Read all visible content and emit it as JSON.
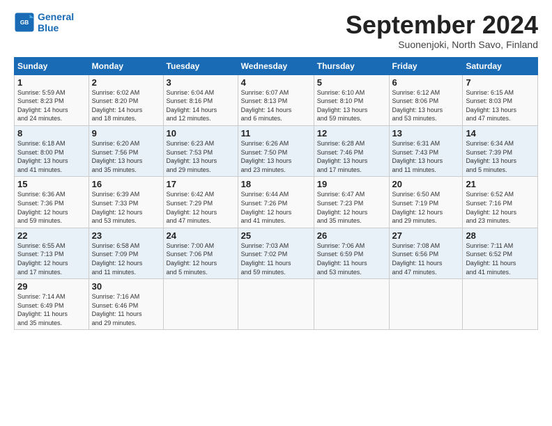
{
  "logo": {
    "line1": "General",
    "line2": "Blue"
  },
  "title": "September 2024",
  "subtitle": "Suonenjoki, North Savo, Finland",
  "headers": [
    "Sunday",
    "Monday",
    "Tuesday",
    "Wednesday",
    "Thursday",
    "Friday",
    "Saturday"
  ],
  "weeks": [
    [
      {
        "day": "1",
        "info": "Sunrise: 5:59 AM\nSunset: 8:23 PM\nDaylight: 14 hours\nand 24 minutes."
      },
      {
        "day": "2",
        "info": "Sunrise: 6:02 AM\nSunset: 8:20 PM\nDaylight: 14 hours\nand 18 minutes."
      },
      {
        "day": "3",
        "info": "Sunrise: 6:04 AM\nSunset: 8:16 PM\nDaylight: 14 hours\nand 12 minutes."
      },
      {
        "day": "4",
        "info": "Sunrise: 6:07 AM\nSunset: 8:13 PM\nDaylight: 14 hours\nand 6 minutes."
      },
      {
        "day": "5",
        "info": "Sunrise: 6:10 AM\nSunset: 8:10 PM\nDaylight: 13 hours\nand 59 minutes."
      },
      {
        "day": "6",
        "info": "Sunrise: 6:12 AM\nSunset: 8:06 PM\nDaylight: 13 hours\nand 53 minutes."
      },
      {
        "day": "7",
        "info": "Sunrise: 6:15 AM\nSunset: 8:03 PM\nDaylight: 13 hours\nand 47 minutes."
      }
    ],
    [
      {
        "day": "8",
        "info": "Sunrise: 6:18 AM\nSunset: 8:00 PM\nDaylight: 13 hours\nand 41 minutes."
      },
      {
        "day": "9",
        "info": "Sunrise: 6:20 AM\nSunset: 7:56 PM\nDaylight: 13 hours\nand 35 minutes."
      },
      {
        "day": "10",
        "info": "Sunrise: 6:23 AM\nSunset: 7:53 PM\nDaylight: 13 hours\nand 29 minutes."
      },
      {
        "day": "11",
        "info": "Sunrise: 6:26 AM\nSunset: 7:50 PM\nDaylight: 13 hours\nand 23 minutes."
      },
      {
        "day": "12",
        "info": "Sunrise: 6:28 AM\nSunset: 7:46 PM\nDaylight: 13 hours\nand 17 minutes."
      },
      {
        "day": "13",
        "info": "Sunrise: 6:31 AM\nSunset: 7:43 PM\nDaylight: 13 hours\nand 11 minutes."
      },
      {
        "day": "14",
        "info": "Sunrise: 6:34 AM\nSunset: 7:39 PM\nDaylight: 13 hours\nand 5 minutes."
      }
    ],
    [
      {
        "day": "15",
        "info": "Sunrise: 6:36 AM\nSunset: 7:36 PM\nDaylight: 12 hours\nand 59 minutes."
      },
      {
        "day": "16",
        "info": "Sunrise: 6:39 AM\nSunset: 7:33 PM\nDaylight: 12 hours\nand 53 minutes."
      },
      {
        "day": "17",
        "info": "Sunrise: 6:42 AM\nSunset: 7:29 PM\nDaylight: 12 hours\nand 47 minutes."
      },
      {
        "day": "18",
        "info": "Sunrise: 6:44 AM\nSunset: 7:26 PM\nDaylight: 12 hours\nand 41 minutes."
      },
      {
        "day": "19",
        "info": "Sunrise: 6:47 AM\nSunset: 7:23 PM\nDaylight: 12 hours\nand 35 minutes."
      },
      {
        "day": "20",
        "info": "Sunrise: 6:50 AM\nSunset: 7:19 PM\nDaylight: 12 hours\nand 29 minutes."
      },
      {
        "day": "21",
        "info": "Sunrise: 6:52 AM\nSunset: 7:16 PM\nDaylight: 12 hours\nand 23 minutes."
      }
    ],
    [
      {
        "day": "22",
        "info": "Sunrise: 6:55 AM\nSunset: 7:13 PM\nDaylight: 12 hours\nand 17 minutes."
      },
      {
        "day": "23",
        "info": "Sunrise: 6:58 AM\nSunset: 7:09 PM\nDaylight: 12 hours\nand 11 minutes."
      },
      {
        "day": "24",
        "info": "Sunrise: 7:00 AM\nSunset: 7:06 PM\nDaylight: 12 hours\nand 5 minutes."
      },
      {
        "day": "25",
        "info": "Sunrise: 7:03 AM\nSunset: 7:02 PM\nDaylight: 11 hours\nand 59 minutes."
      },
      {
        "day": "26",
        "info": "Sunrise: 7:06 AM\nSunset: 6:59 PM\nDaylight: 11 hours\nand 53 minutes."
      },
      {
        "day": "27",
        "info": "Sunrise: 7:08 AM\nSunset: 6:56 PM\nDaylight: 11 hours\nand 47 minutes."
      },
      {
        "day": "28",
        "info": "Sunrise: 7:11 AM\nSunset: 6:52 PM\nDaylight: 11 hours\nand 41 minutes."
      }
    ],
    [
      {
        "day": "29",
        "info": "Sunrise: 7:14 AM\nSunset: 6:49 PM\nDaylight: 11 hours\nand 35 minutes."
      },
      {
        "day": "30",
        "info": "Sunrise: 7:16 AM\nSunset: 6:46 PM\nDaylight: 11 hours\nand 29 minutes."
      },
      {
        "day": "",
        "info": ""
      },
      {
        "day": "",
        "info": ""
      },
      {
        "day": "",
        "info": ""
      },
      {
        "day": "",
        "info": ""
      },
      {
        "day": "",
        "info": ""
      }
    ]
  ]
}
